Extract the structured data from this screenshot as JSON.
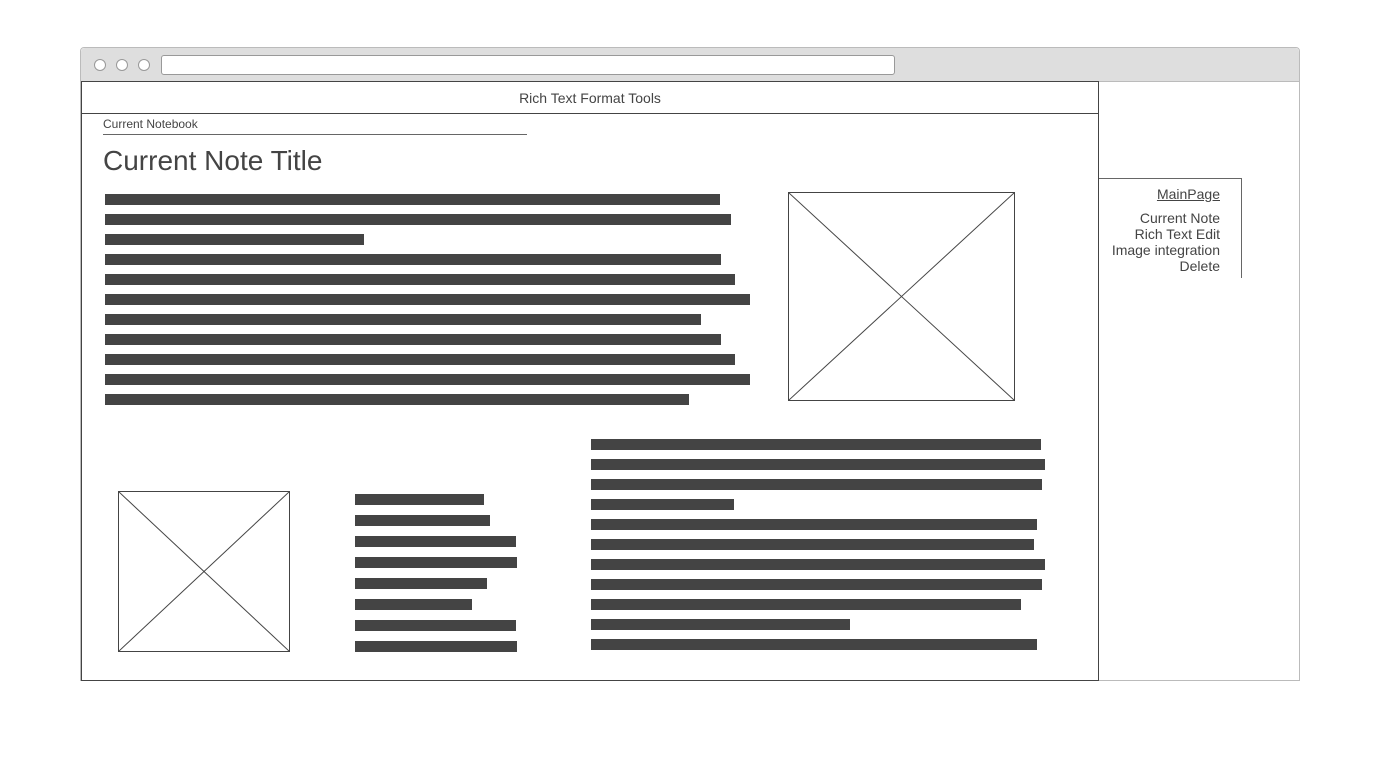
{
  "browser": {
    "url": ""
  },
  "editor": {
    "toolbar_label": "Rich Text Format Tools",
    "notebook_label": "Current Notebook",
    "note_title": "Current Note Title"
  },
  "sidebar": {
    "main_link": "MainPage",
    "items": [
      "Current Note",
      "Rich Text Edit",
      "Image integration",
      "Delete"
    ]
  },
  "colors": {
    "text_placeholder": "#444444",
    "window_chrome": "#dedede"
  }
}
